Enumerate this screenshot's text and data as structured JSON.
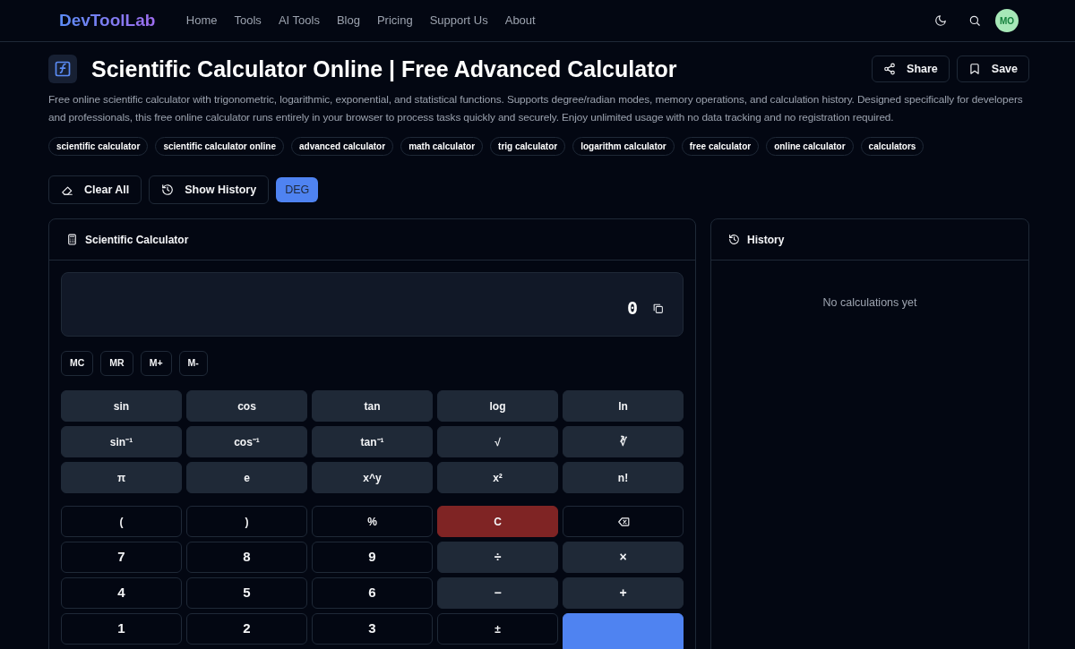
{
  "navbar": {
    "brand": "DevToolLab",
    "links": [
      "Home",
      "Tools",
      "AI Tools",
      "Blog",
      "Pricing",
      "Support Us",
      "About"
    ],
    "avatar": "MO"
  },
  "header": {
    "title": "Scientific Calculator Online | Free Advanced Calculator",
    "actions": [
      "Share",
      "Save"
    ],
    "description": "Free online scientific calculator with trigonometric, logarithmic, exponential, and statistical functions. Supports degree/radian modes, memory operations, and calculation history. Designed specifically for developers and professionals, this free online calculator runs entirely in your browser to process tasks quickly and securely. Enjoy unlimited usage with no data tracking and no registration required.",
    "tags": [
      "scientific calculator",
      "scientific calculator online",
      "advanced calculator",
      "math calculator",
      "trig calculator",
      "logarithm calculator",
      "free calculator",
      "online calculator",
      "calculators"
    ]
  },
  "toolbar": {
    "clear": "Clear All",
    "history": "Show History",
    "angle_mode": "DEG"
  },
  "calculator": {
    "title": "Scientific Calculator",
    "display": "0",
    "memory": [
      "MC",
      "MR",
      "M+",
      "M-"
    ],
    "function_keys": [
      {
        "label": "sin",
        "kind": "func"
      },
      {
        "label": "cos",
        "kind": "func"
      },
      {
        "label": "tan",
        "kind": "func"
      },
      {
        "label": "log",
        "kind": "func"
      },
      {
        "label": "ln",
        "kind": "func"
      },
      {
        "label": "sin⁻¹",
        "kind": "func"
      },
      {
        "label": "cos⁻¹",
        "kind": "func"
      },
      {
        "label": "tan⁻¹",
        "kind": "func"
      },
      {
        "label": "√",
        "kind": "func"
      },
      {
        "label": "∛",
        "kind": "func"
      },
      {
        "label": "π",
        "kind": "func"
      },
      {
        "label": "e",
        "kind": "func"
      },
      {
        "label": "x^y",
        "kind": "func"
      },
      {
        "label": "x²",
        "kind": "func"
      },
      {
        "label": "n!",
        "kind": "func"
      }
    ],
    "basic_keys": [
      {
        "label": "(",
        "kind": "plain"
      },
      {
        "label": ")",
        "kind": "plain"
      },
      {
        "label": "%",
        "kind": "plain"
      },
      {
        "label": "C",
        "kind": "danger"
      },
      {
        "kind": "backspace"
      },
      {
        "label": "7",
        "kind": "digit"
      },
      {
        "label": "8",
        "kind": "digit"
      },
      {
        "label": "9",
        "kind": "digit"
      },
      {
        "label": "÷",
        "kind": "op"
      },
      {
        "label": "×",
        "kind": "op"
      },
      {
        "label": "4",
        "kind": "digit"
      },
      {
        "label": "5",
        "kind": "digit"
      },
      {
        "label": "6",
        "kind": "digit"
      },
      {
        "label": "−",
        "kind": "op"
      },
      {
        "label": "+",
        "kind": "op"
      },
      {
        "label": "1",
        "kind": "digit"
      },
      {
        "label": "2",
        "kind": "digit"
      },
      {
        "label": "3",
        "kind": "digit"
      },
      {
        "label": "±",
        "kind": "plain"
      },
      {
        "kind": "equals"
      }
    ]
  },
  "history": {
    "title": "History",
    "empty": "No calculations yet"
  }
}
